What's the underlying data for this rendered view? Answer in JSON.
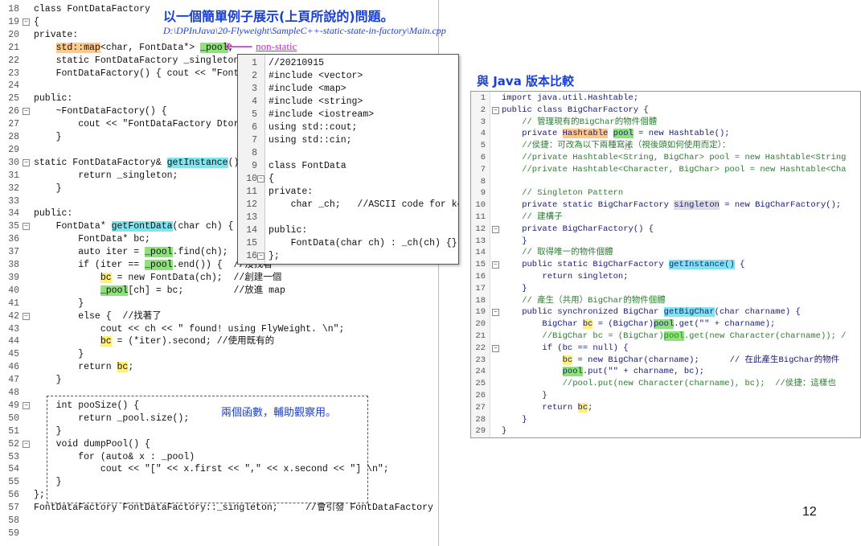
{
  "slide": {
    "title": "以一個簡單例子展示(上頁所說的)問題。",
    "path": "D:\\DPInJava\\20-Flyweight\\SampleC++-static-state-in-factory\\Main.cpp",
    "annotation_non_static": "non-static",
    "java_heading": "與 Java 版本比較",
    "box_note": "兩個函數，輔助觀察用。",
    "page_number": "12"
  },
  "left_code": [
    {
      "n": "18",
      "t": "class FontDataFactory"
    },
    {
      "n": "19",
      "t": "{"
    },
    {
      "n": "20",
      "t": "private:"
    },
    {
      "n": "21",
      "t": "    std::map<char, FontData*> _pool;"
    },
    {
      "n": "22",
      "t": "    static FontDataFactory _singleton;"
    },
    {
      "n": "23",
      "t": "    FontDataFactory() { cout << \"FontDat"
    },
    {
      "n": "24",
      "t": ""
    },
    {
      "n": "25",
      "t": "public:"
    },
    {
      "n": "26",
      "t": "    ~FontDataFactory() {"
    },
    {
      "n": "27",
      "t": "        cout << \"FontDataFactory Dtor \\n"
    },
    {
      "n": "28",
      "t": "    }"
    },
    {
      "n": "29",
      "t": ""
    },
    {
      "n": "30",
      "t": "static FontDataFactory& getInstance() {"
    },
    {
      "n": "31",
      "t": "        return _singleton;"
    },
    {
      "n": "32",
      "t": "    }"
    },
    {
      "n": "33",
      "t": ""
    },
    {
      "n": "34",
      "t": "public:"
    },
    {
      "n": "35",
      "t": "    FontData* getFontData(char ch) {"
    },
    {
      "n": "36",
      "t": "        FontData* bc;"
    },
    {
      "n": "37",
      "t": "        auto iter = _pool.find(ch);"
    },
    {
      "n": "38",
      "t": "        if (iter == _pool.end()) {  //沒找著"
    },
    {
      "n": "39",
      "t": "            bc = new FontData(ch);  //創建一個"
    },
    {
      "n": "40",
      "t": "            _pool[ch] = bc;         //放進 map"
    },
    {
      "n": "41",
      "t": "        }"
    },
    {
      "n": "42",
      "t": "        else {  //找著了"
    },
    {
      "n": "43",
      "t": "            cout << ch << \" found! using FlyWeight. \\n\";"
    },
    {
      "n": "44",
      "t": "            bc = (*iter).second; //使用既有的"
    },
    {
      "n": "45",
      "t": "        }"
    },
    {
      "n": "46",
      "t": "        return bc;"
    },
    {
      "n": "47",
      "t": "    }"
    },
    {
      "n": "48",
      "t": ""
    },
    {
      "n": "49",
      "t": "    int pooSize() {"
    },
    {
      "n": "50",
      "t": "        return _pool.size();"
    },
    {
      "n": "51",
      "t": "    }"
    },
    {
      "n": "52",
      "t": "    void dumpPool() {"
    },
    {
      "n": "53",
      "t": "        for (auto& x : _pool)"
    },
    {
      "n": "54",
      "t": "            cout << \"[\" << x.first << \",\" << x.second << \"] \\n\";"
    },
    {
      "n": "55",
      "t": "    }"
    },
    {
      "n": "56",
      "t": "};"
    },
    {
      "n": "57",
      "t": "FontDataFactory FontDataFactory::_singleton;     //會引發 FontDataFactory Ctor"
    },
    {
      "n": "58",
      "t": ""
    },
    {
      "n": "59",
      "t": ""
    }
  ],
  "popup_code": [
    {
      "n": "1",
      "t": "//20210915"
    },
    {
      "n": "2",
      "t": "#include <vector>"
    },
    {
      "n": "3",
      "t": "#include <map>"
    },
    {
      "n": "4",
      "t": "#include <string>"
    },
    {
      "n": "5",
      "t": "#include <iostream>"
    },
    {
      "n": "6",
      "t": "using std::cout;"
    },
    {
      "n": "7",
      "t": "using std::cin;"
    },
    {
      "n": "8",
      "t": ""
    },
    {
      "n": "9",
      "t": "class FontData"
    },
    {
      "n": "10",
      "t": "{"
    },
    {
      "n": "11",
      "t": "private:"
    },
    {
      "n": "12",
      "t": "    char _ch;   //ASCII code for key"
    },
    {
      "n": "13",
      "t": ""
    },
    {
      "n": "14",
      "t": "public:"
    },
    {
      "n": "15",
      "t": "    FontData(char ch) : _ch(ch) {}"
    },
    {
      "n": "16",
      "t": "};"
    }
  ],
  "java_code": [
    {
      "n": "1",
      "t": "import java.util.Hashtable;"
    },
    {
      "n": "2",
      "t": "public class BigCharFactory {"
    },
    {
      "n": "3",
      "t": "    // 管理現有的BigChar的物件個體"
    },
    {
      "n": "4",
      "t": "    private Hashtable pool = new Hashtable();"
    },
    {
      "n": "5",
      "t": "    //侯捷：可改為以下兩種寫法（視後頭如何使用而定）："
    },
    {
      "n": "6",
      "t": "    //private Hashtable<String, BigChar> pool = new Hashtable<String"
    },
    {
      "n": "7",
      "t": "    //private Hashtable<Character, BigChar> pool = new Hashtable<Cha"
    },
    {
      "n": "8",
      "t": ""
    },
    {
      "n": "9",
      "t": "    // Singleton Pattern"
    },
    {
      "n": "10",
      "t": "    private static BigCharFactory singleton = new BigCharFactory();"
    },
    {
      "n": "11",
      "t": "    // 建構子"
    },
    {
      "n": "12",
      "t": "    private BigCharFactory() {"
    },
    {
      "n": "13",
      "t": "    }"
    },
    {
      "n": "14",
      "t": "    // 取得唯一的物件個體"
    },
    {
      "n": "15",
      "t": "    public static BigCharFactory getInstance() {"
    },
    {
      "n": "16",
      "t": "        return singleton;"
    },
    {
      "n": "17",
      "t": "    }"
    },
    {
      "n": "18",
      "t": "    // 產生（共用）BigChar的物件個體"
    },
    {
      "n": "19",
      "t": "    public synchronized BigChar getBigChar(char charname) {"
    },
    {
      "n": "20",
      "t": "        BigChar bc = (BigChar)pool.get(\"\" + charname);"
    },
    {
      "n": "21",
      "t": "        //BigChar bc = (BigChar)pool.get(new Character(charname)); /"
    },
    {
      "n": "22",
      "t": "        if (bc == null) {"
    },
    {
      "n": "23",
      "t": "            bc = new BigChar(charname);      // 在此產生BigChar的物件"
    },
    {
      "n": "24",
      "t": "            pool.put(\"\" + charname, bc);"
    },
    {
      "n": "25",
      "t": "            //pool.put(new Character(charname), bc);  //侯捷：這樣也"
    },
    {
      "n": "26",
      "t": "        }"
    },
    {
      "n": "27",
      "t": "        return bc;"
    },
    {
      "n": "28",
      "t": "    }"
    },
    {
      "n": "29",
      "t": "}"
    }
  ],
  "colors": {
    "title": "#1a3fd6",
    "path": "#1a3fd6",
    "non_static": "#cc22cc",
    "box_note": "#1a3fd6",
    "highlight_orange": "#ffc98a",
    "highlight_green": "#8ee27a",
    "highlight_cyan": "#7fe6f0",
    "highlight_yellow": "#fff07a"
  },
  "icons": {
    "left_arrow": "arrow-left-icon",
    "cursor": "hand-cursor-icon"
  }
}
